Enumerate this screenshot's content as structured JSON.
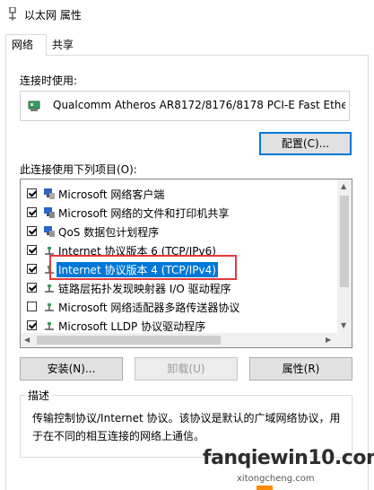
{
  "window": {
    "title": "以太网 属性"
  },
  "tabs": [
    {
      "label": "网络",
      "active": true
    },
    {
      "label": "共享",
      "active": false
    }
  ],
  "connect_using": {
    "label": "连接时使用:",
    "adapter_name": "Qualcomm Atheros AR8172/8176/8178 PCI-E Fast Ethe",
    "configure_button": "配置(C)..."
  },
  "items_section": {
    "label": "此连接使用下列项目(O):",
    "items": [
      {
        "label": "Microsoft 网络客户端",
        "checked": true,
        "icon": "network-client-icon"
      },
      {
        "label": "Microsoft 网络的文件和打印机共享",
        "checked": true,
        "icon": "file-printer-sharing-icon"
      },
      {
        "label": "QoS 数据包计划程序",
        "checked": true,
        "icon": "qos-icon"
      },
      {
        "label": "Internet 协议版本 6 (TCP/IPv6)",
        "checked": true,
        "icon": "protocol-icon"
      },
      {
        "label": "Internet 协议版本 4 (TCP/IPv4)",
        "checked": true,
        "icon": "protocol-icon",
        "selected": true
      },
      {
        "label": "链路层拓扑发现映射器 I/O 驱动程序",
        "checked": true,
        "icon": "protocol-icon"
      },
      {
        "label": "Microsoft 网络适配器多路传送器协议",
        "checked": false,
        "icon": "protocol-icon"
      },
      {
        "label": "Microsoft LLDP 协议驱动程序",
        "checked": true,
        "icon": "protocol-icon"
      }
    ]
  },
  "buttons": {
    "install": "安装(N)...",
    "uninstall": "卸载(U)",
    "properties": "属性(R)"
  },
  "description": {
    "legend": "描述",
    "text": "传输控制协议/Internet 协议。该协议是默认的广域网络协议，用于在不同的相互连接的网络上通信。"
  },
  "watermark": {
    "main": "fanqiewin10.com",
    "sub": "xitongcheng.com"
  },
  "colors": {
    "accent": "#0078d7",
    "highlight_box": "#e33a3a"
  }
}
